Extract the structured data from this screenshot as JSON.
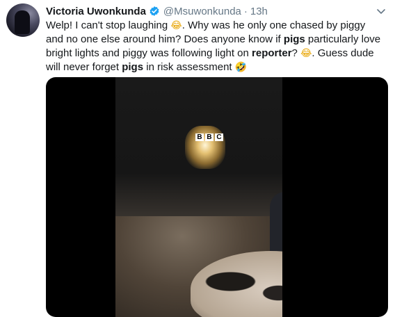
{
  "tweet": {
    "display_name": "Victoria Uwonkunda",
    "handle": "@Msuwonkunda",
    "separator": "·",
    "time": "13h",
    "text_segments": [
      {
        "t": "Welp! I can't stop laughing ",
        "b": false
      },
      {
        "t": "😂",
        "emoji": true
      },
      {
        "t": ". Why was he only one chased by piggy and no one else around him? Does anyone know if ",
        "b": false
      },
      {
        "t": "pigs",
        "b": true
      },
      {
        "t": " particularly love bright lights and piggy was following light on ",
        "b": false
      },
      {
        "t": "reporter",
        "b": true
      },
      {
        "t": "? ",
        "b": false
      },
      {
        "t": "😂",
        "emoji": true
      },
      {
        "t": ". Guess dude will never forget ",
        "b": false
      },
      {
        "t": "pigs",
        "b": true
      },
      {
        "t": " in risk assessment ",
        "b": false
      },
      {
        "t": "🤣",
        "emoji": true
      }
    ],
    "media_watermark": [
      "B",
      "B",
      "C"
    ]
  },
  "colors": {
    "verified_blue": "#1da1f2",
    "secondary_text": "#657786",
    "primary_text": "#14171a"
  },
  "icons": {
    "verified": "verified-badge-icon",
    "more": "chevron-down-icon"
  }
}
